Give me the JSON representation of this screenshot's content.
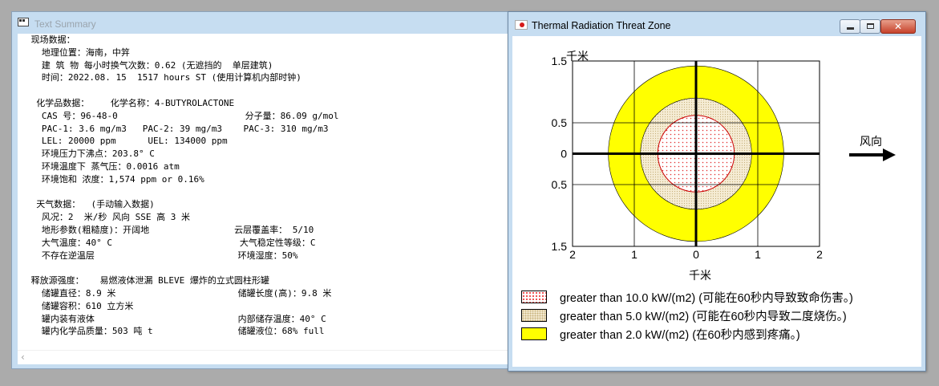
{
  "summary_window": {
    "title": "Text Summary",
    "lines": [
      " 现场数据：",
      "   地理位置：海南，中笄",
      "   建 筑 物 每小时换气次数：0.62 (无遮挡的  单层建筑)",
      "   时间：2022.08. 15  1517 hours ST (使用计算机内部时钟)",
      "",
      "  化学品数据：    化学名称：4-BUTYROLACTONE",
      "   CAS 号：96-48-0                        分子量：86.09 g/mol",
      "   PAC-1: 3.6 mg/m3   PAC-2: 39 mg/m3    PAC-3: 310 mg/m3",
      "   LEL: 20000 ppm      UEL: 134000 ppm",
      "   环境压力下沸点：203.8° C",
      "   环境温度下 蒸气压：0.0016 atm",
      "   环境饱和 浓度：1,574 ppm or 0.16%",
      "",
      "  天气数据：  (手动输入数据)",
      "   风况：2  米/秒 风向 SSE 高 3 米",
      "   地形参数(粗糙度)：开阔地                云层覆盖率： 5/10",
      "   大气温度：40° C                        大气稳定性等级：C",
      "   不存在逆温层                           环境湿度：50%",
      "",
      " 释放源强度：   易燃液体泄漏 BLEVE 爆炸的立式圆柱形罐",
      "   储罐直径：8.9 米                       储罐长度(高)：9.8 米",
      "   储罐容积：610 立方米",
      "   罐内装有液体                           内部储存温度：40° C",
      "   罐内化学品质量：503 吨 t                储罐液位：68% full"
    ]
  },
  "thermal_window": {
    "title": "Thermal Radiation Threat Zone",
    "close_glyph": "✕",
    "wind_label": "风向",
    "colors": {
      "red_zone": "#e33333",
      "orange_zone": "#f5ecd4",
      "yellow_zone": "#ffff00"
    },
    "chart_data": {
      "type": "threat_zone_plot",
      "ylabel": "千米",
      "xlabel": "千米",
      "x_ticks": [
        "2",
        "1",
        "0",
        "1",
        "2"
      ],
      "y_ticks": [
        "1.5",
        "0.5",
        "0",
        "0.5",
        "1.5"
      ],
      "xlim": [
        -2,
        2
      ],
      "ylim": [
        -1.5,
        1.5
      ],
      "zones": [
        {
          "label": "greater than 2.0 kW/(m2) (在60秒内感到疼痛。)",
          "radius_km": 1.42,
          "color": "#ffff00"
        },
        {
          "label": "greater than 5.0 kW/(m2) (可能在60秒内导致二度烧伤。)",
          "radius_km": 0.9,
          "color": "#f5ecd4"
        },
        {
          "label": "greater than 10.0 kW/(m2) (可能在60秒内导致致命伤害。)",
          "radius_km": 0.62,
          "color": "#e33333"
        }
      ]
    },
    "legend": [
      {
        "text": "greater than 10.0 kW/(m2) (可能在60秒内导致致命伤害。)"
      },
      {
        "text": "greater than 5.0 kW/(m2) (可能在60秒内导致二度烧伤。)"
      },
      {
        "text": "greater than 2.0 kW/(m2) (在60秒内感到疼痛。)"
      }
    ]
  }
}
